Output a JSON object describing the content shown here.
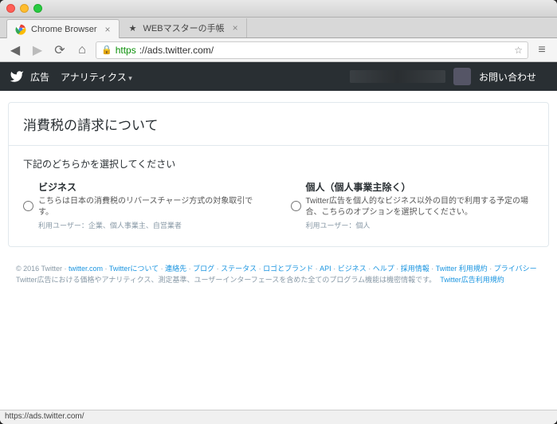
{
  "browser": {
    "tabs": [
      {
        "title": "Chrome Browser",
        "active": true
      },
      {
        "title": "WEBマスターの手帳",
        "active": false
      }
    ],
    "url_proto": "https",
    "url_rest": "://ads.twitter.com/",
    "status": "https://ads.twitter.com/"
  },
  "nav": {
    "brand": "広告",
    "analytics": "アナリティクス",
    "contact": "お問い合わせ"
  },
  "card": {
    "title": "消費税の請求について",
    "subtitle": "下記のどちらかを選択してください",
    "options": [
      {
        "title": "ビジネス",
        "desc": "こちらは日本の消費税のリバースチャージ方式の対象取引です。",
        "meta": "利用ユーザー：企業、個人事業主、自営業者"
      },
      {
        "title": "個人（個人事業主除く）",
        "desc": "Twitter広告を個人的なビジネス以外の目的で利用する予定の場合、こちらのオプションを選択してください。",
        "meta": "利用ユーザー：個人"
      }
    ]
  },
  "footer": {
    "copyright": "© 2016 Twitter",
    "links": [
      "twitter.com",
      "Twitterについて",
      "連絡先",
      "ブログ",
      "ステータス",
      "ロゴとブランド",
      "API",
      "ビジネス",
      "ヘルプ",
      "採用情報",
      "Twitter 利用規約",
      "プライバシー"
    ],
    "note": "Twitter広告における価格やアナリティクス、測定基準、ユーザーインターフェースを含めた全てのプログラム機能は機密情報です。",
    "note_link": "Twitter広告利用規約"
  }
}
